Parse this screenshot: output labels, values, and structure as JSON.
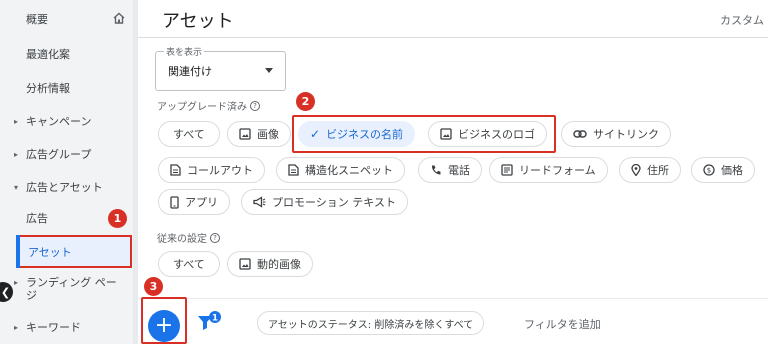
{
  "sidebar": {
    "overview": "概要",
    "recommendations": "最適化案",
    "insights": "分析情報",
    "campaigns": "キャンペーン",
    "ad_groups": "広告グループ",
    "ads_and_assets": "広告とアセット",
    "ads": "広告",
    "assets": "アセット",
    "landing_pages": "ランディング ページ",
    "keywords": "キーワード"
  },
  "header": {
    "title": "アセット",
    "custom": "カスタム"
  },
  "view": {
    "label": "表を表示",
    "value": "関連付け"
  },
  "upgraded": {
    "label": "アップグレード済み",
    "chips": {
      "all": "すべて",
      "image": "画像",
      "business_name": "ビジネスの名前",
      "business_logo": "ビジネスのロゴ",
      "sitelink": "サイトリンク",
      "callout": "コールアウト",
      "structured_snippet": "構造化スニペット",
      "call": "電話",
      "lead_form": "リードフォーム",
      "location": "住所",
      "price": "価格",
      "app": "アプリ",
      "promotion": "プロモーション テキスト"
    }
  },
  "legacy": {
    "label": "従来の設定",
    "chips": {
      "all": "すべて",
      "dynamic_image": "動的画像"
    }
  },
  "toolbar": {
    "filter_badge": "1",
    "filter_chip": "アセットのステータス: 削除済みを除くすべて",
    "add_filter": "フィルタを追加"
  },
  "badges": {
    "one": "1",
    "two": "2",
    "three": "3"
  },
  "colors": {
    "accent": "#1a73e8",
    "highlight": "#d93025",
    "selected_bg": "#e8f0fe"
  }
}
